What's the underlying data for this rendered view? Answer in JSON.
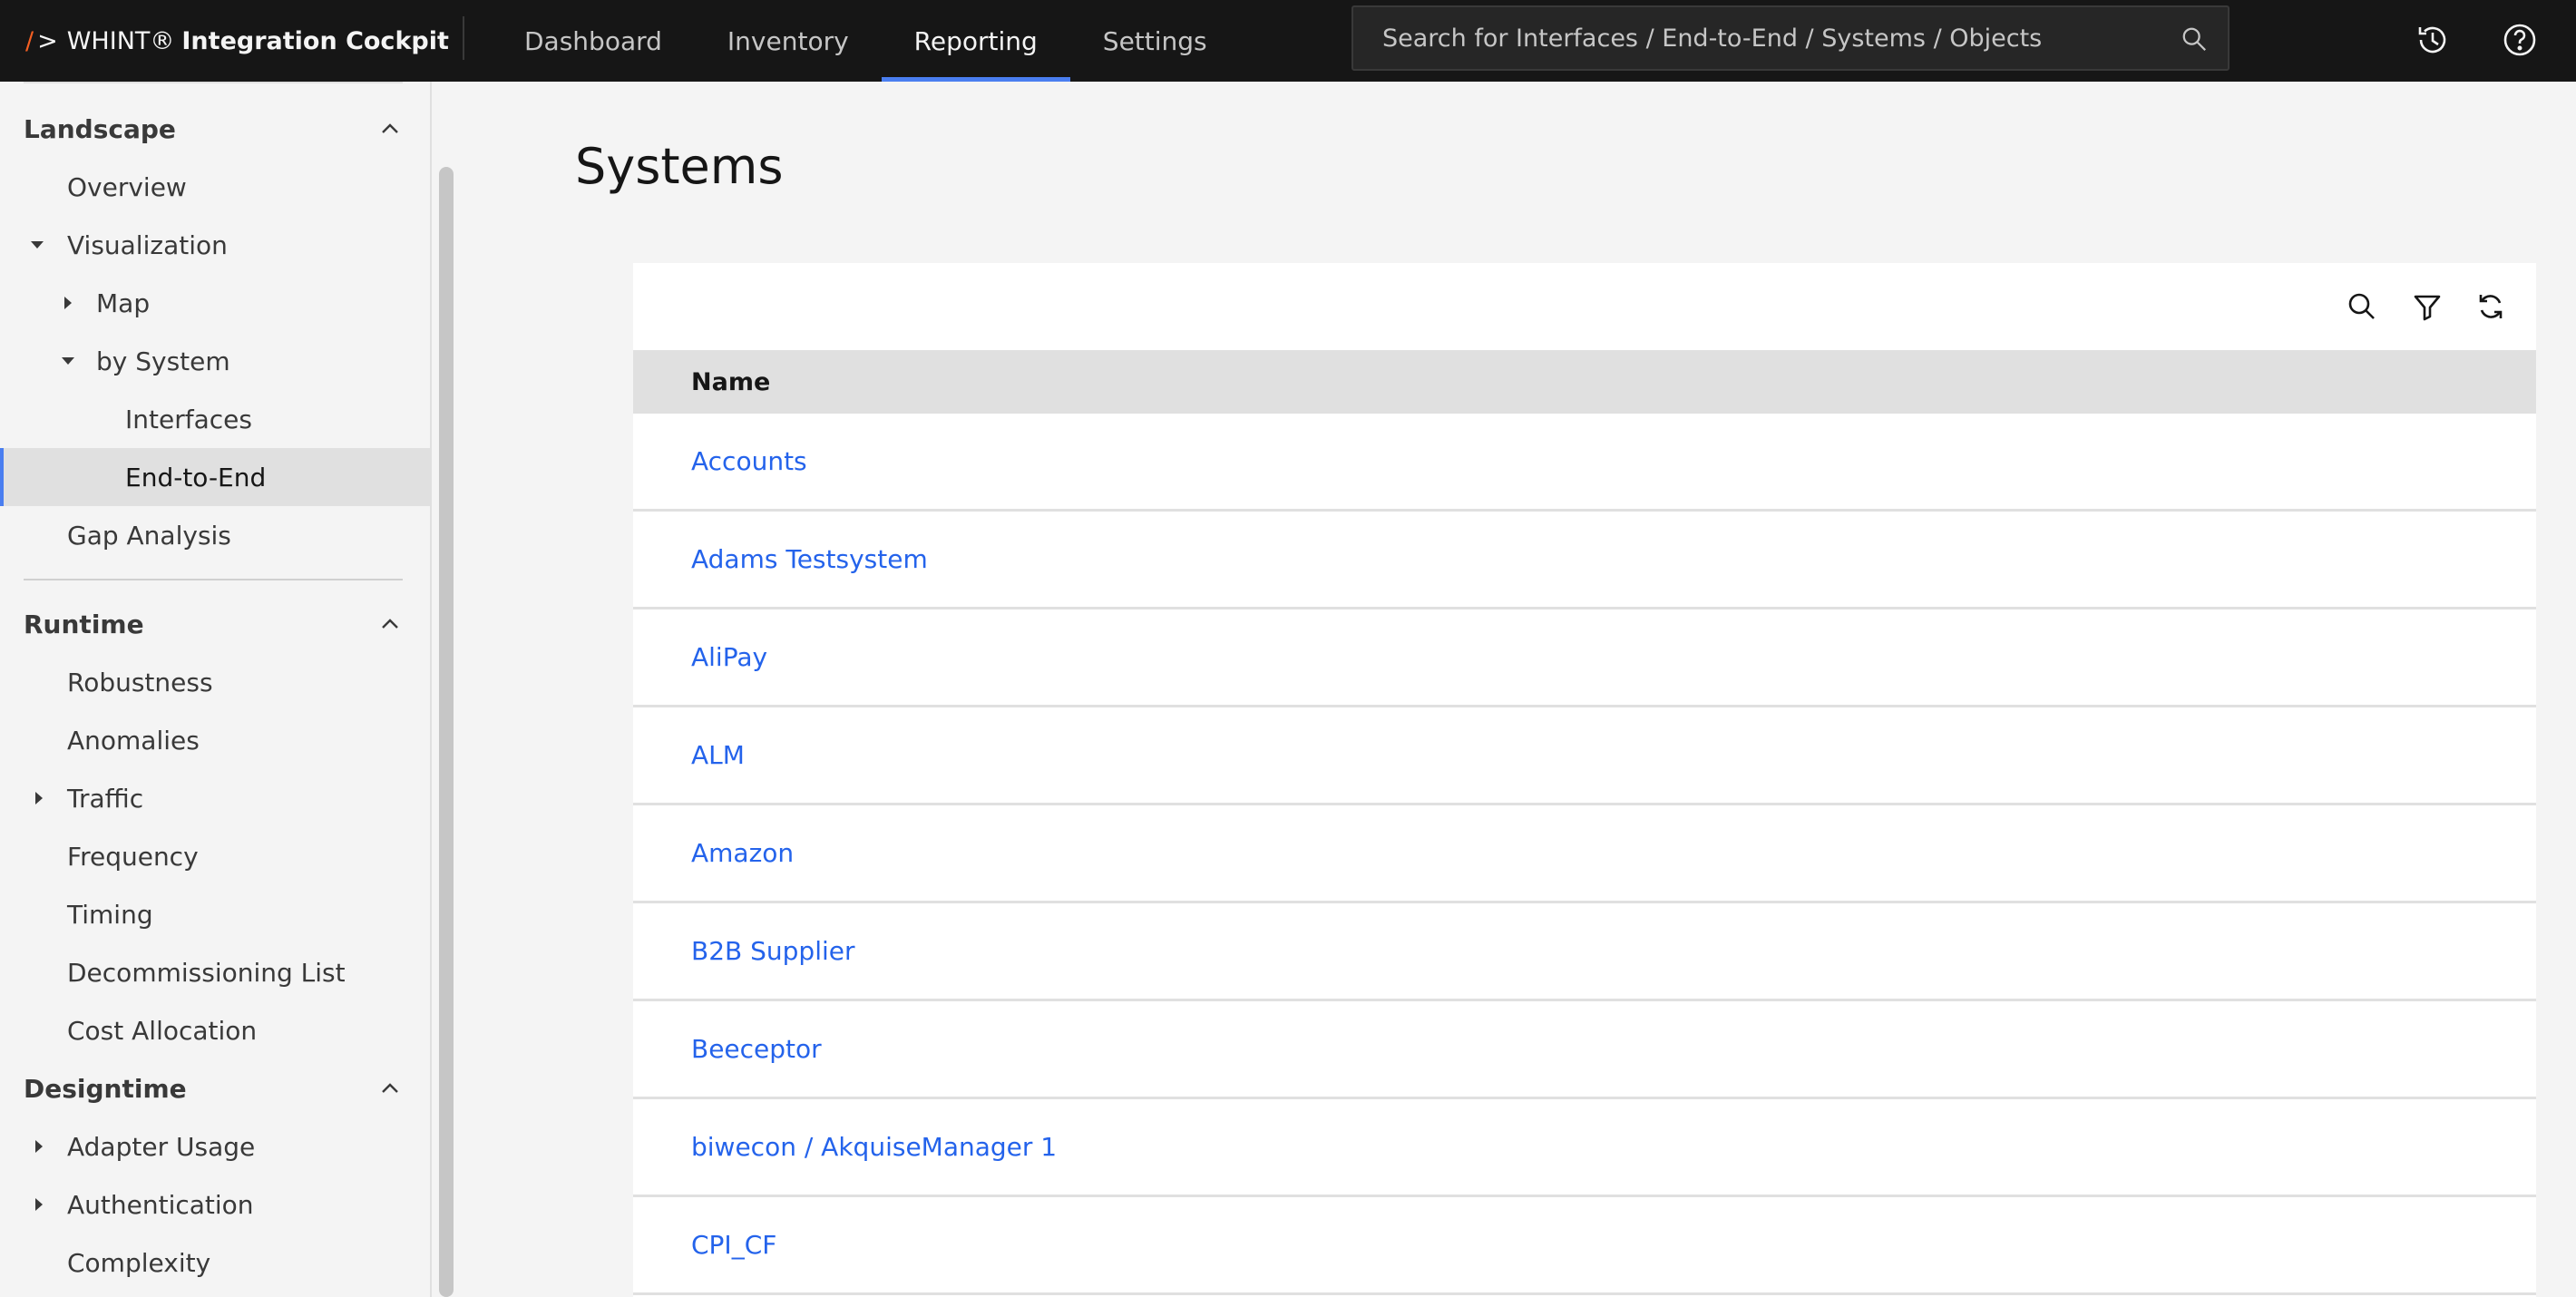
{
  "app": {
    "logo_mark": "/",
    "logo_arrow": ">",
    "brand": "WHINT®",
    "product": "Integration Cockpit"
  },
  "nav": {
    "items": [
      "Dashboard",
      "Inventory",
      "Reporting",
      "Settings"
    ],
    "active": "Reporting"
  },
  "search": {
    "placeholder": "Search for Interfaces / End-to-End / Systems / Objects",
    "value": ""
  },
  "header_icons": [
    "history-icon",
    "help-icon"
  ],
  "sidebar": {
    "sections": [
      {
        "title": "Landscape",
        "expanded": true,
        "items": [
          {
            "label": "Overview",
            "level": 1,
            "caret": "none"
          },
          {
            "label": "Visualization",
            "level": 1,
            "caret": "expanded"
          },
          {
            "label": "Map",
            "level": 2,
            "caret": "collapsed"
          },
          {
            "label": "by System",
            "level": 2,
            "caret": "expanded"
          },
          {
            "label": "Interfaces",
            "level": 3,
            "caret": "none"
          },
          {
            "label": "End-to-End",
            "level": 3,
            "caret": "none",
            "active": true
          },
          {
            "label": "Gap Analysis",
            "level": 1,
            "caret": "none"
          }
        ]
      },
      {
        "title": "Runtime",
        "expanded": true,
        "items": [
          {
            "label": "Robustness",
            "level": 1,
            "caret": "none"
          },
          {
            "label": "Anomalies",
            "level": 1,
            "caret": "none"
          },
          {
            "label": "Traffic",
            "level": 1,
            "caret": "collapsed"
          },
          {
            "label": "Frequency",
            "level": 1,
            "caret": "none"
          },
          {
            "label": "Timing",
            "level": 1,
            "caret": "none"
          },
          {
            "label": "Decommissioning List",
            "level": 1,
            "caret": "none"
          },
          {
            "label": "Cost Allocation",
            "level": 1,
            "caret": "none"
          }
        ]
      },
      {
        "title": "Designtime",
        "expanded": true,
        "items": [
          {
            "label": "Adapter Usage",
            "level": 1,
            "caret": "collapsed"
          },
          {
            "label": "Authentication",
            "level": 1,
            "caret": "collapsed"
          },
          {
            "label": "Complexity",
            "level": 1,
            "caret": "none"
          }
        ]
      }
    ]
  },
  "main": {
    "title": "Systems",
    "table": {
      "toolbar_icons": [
        "search-icon",
        "filter-icon",
        "refresh-icon"
      ],
      "columns": [
        "Name"
      ],
      "rows": [
        "Accounts",
        "Adams Testsystem",
        "AliPay",
        "ALM",
        "Amazon",
        "B2B Supplier",
        "Beeceptor",
        "biwecon / AkquiseManager 1",
        "CPI_CF"
      ]
    }
  },
  "colors": {
    "header_bg": "#161616",
    "accent": "#4a7ef0",
    "link": "#2463eb",
    "logo_mark": "#f55f22",
    "page_bg": "#f4f4f4"
  }
}
